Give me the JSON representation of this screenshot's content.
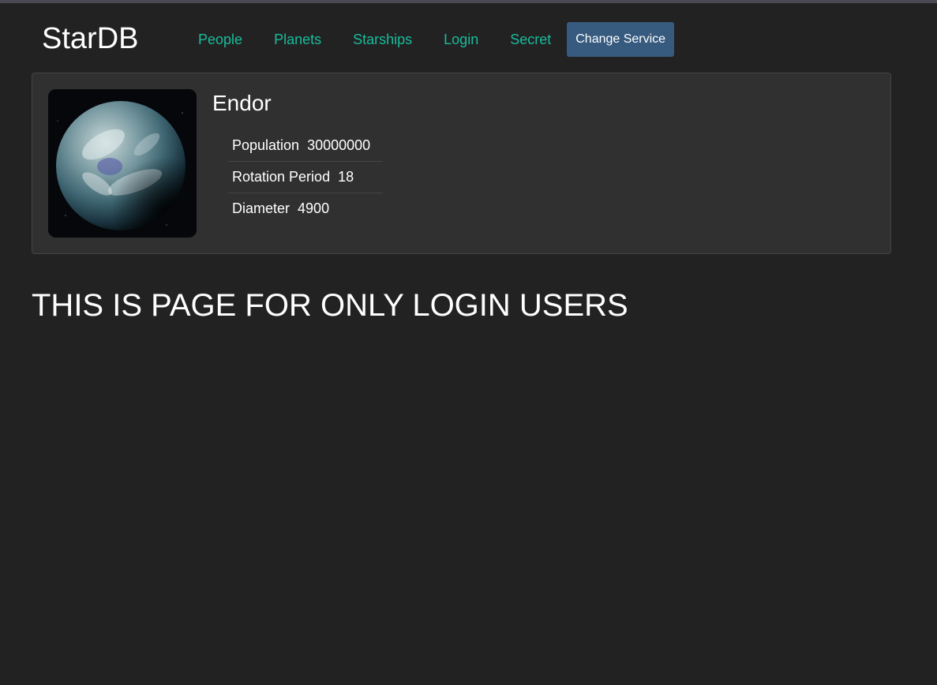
{
  "header": {
    "brand": "StarDB",
    "nav": [
      {
        "label": "People"
      },
      {
        "label": "Planets"
      },
      {
        "label": "Starships"
      },
      {
        "label": "Login"
      },
      {
        "label": "Secret"
      }
    ],
    "change_service_label": "Change Service"
  },
  "planet": {
    "name": "Endor",
    "details": [
      {
        "term": "Population",
        "value": "30000000"
      },
      {
        "term": "Rotation Period",
        "value": "18"
      },
      {
        "term": "Diameter",
        "value": "4900"
      }
    ]
  },
  "secret_message": "THIS IS PAGE FOR ONLY LOGIN USERS",
  "colors": {
    "background": "#222222",
    "card": "#303030",
    "nav_link": "#18bc9c",
    "button": "#375a7f",
    "text": "#ffffff"
  }
}
